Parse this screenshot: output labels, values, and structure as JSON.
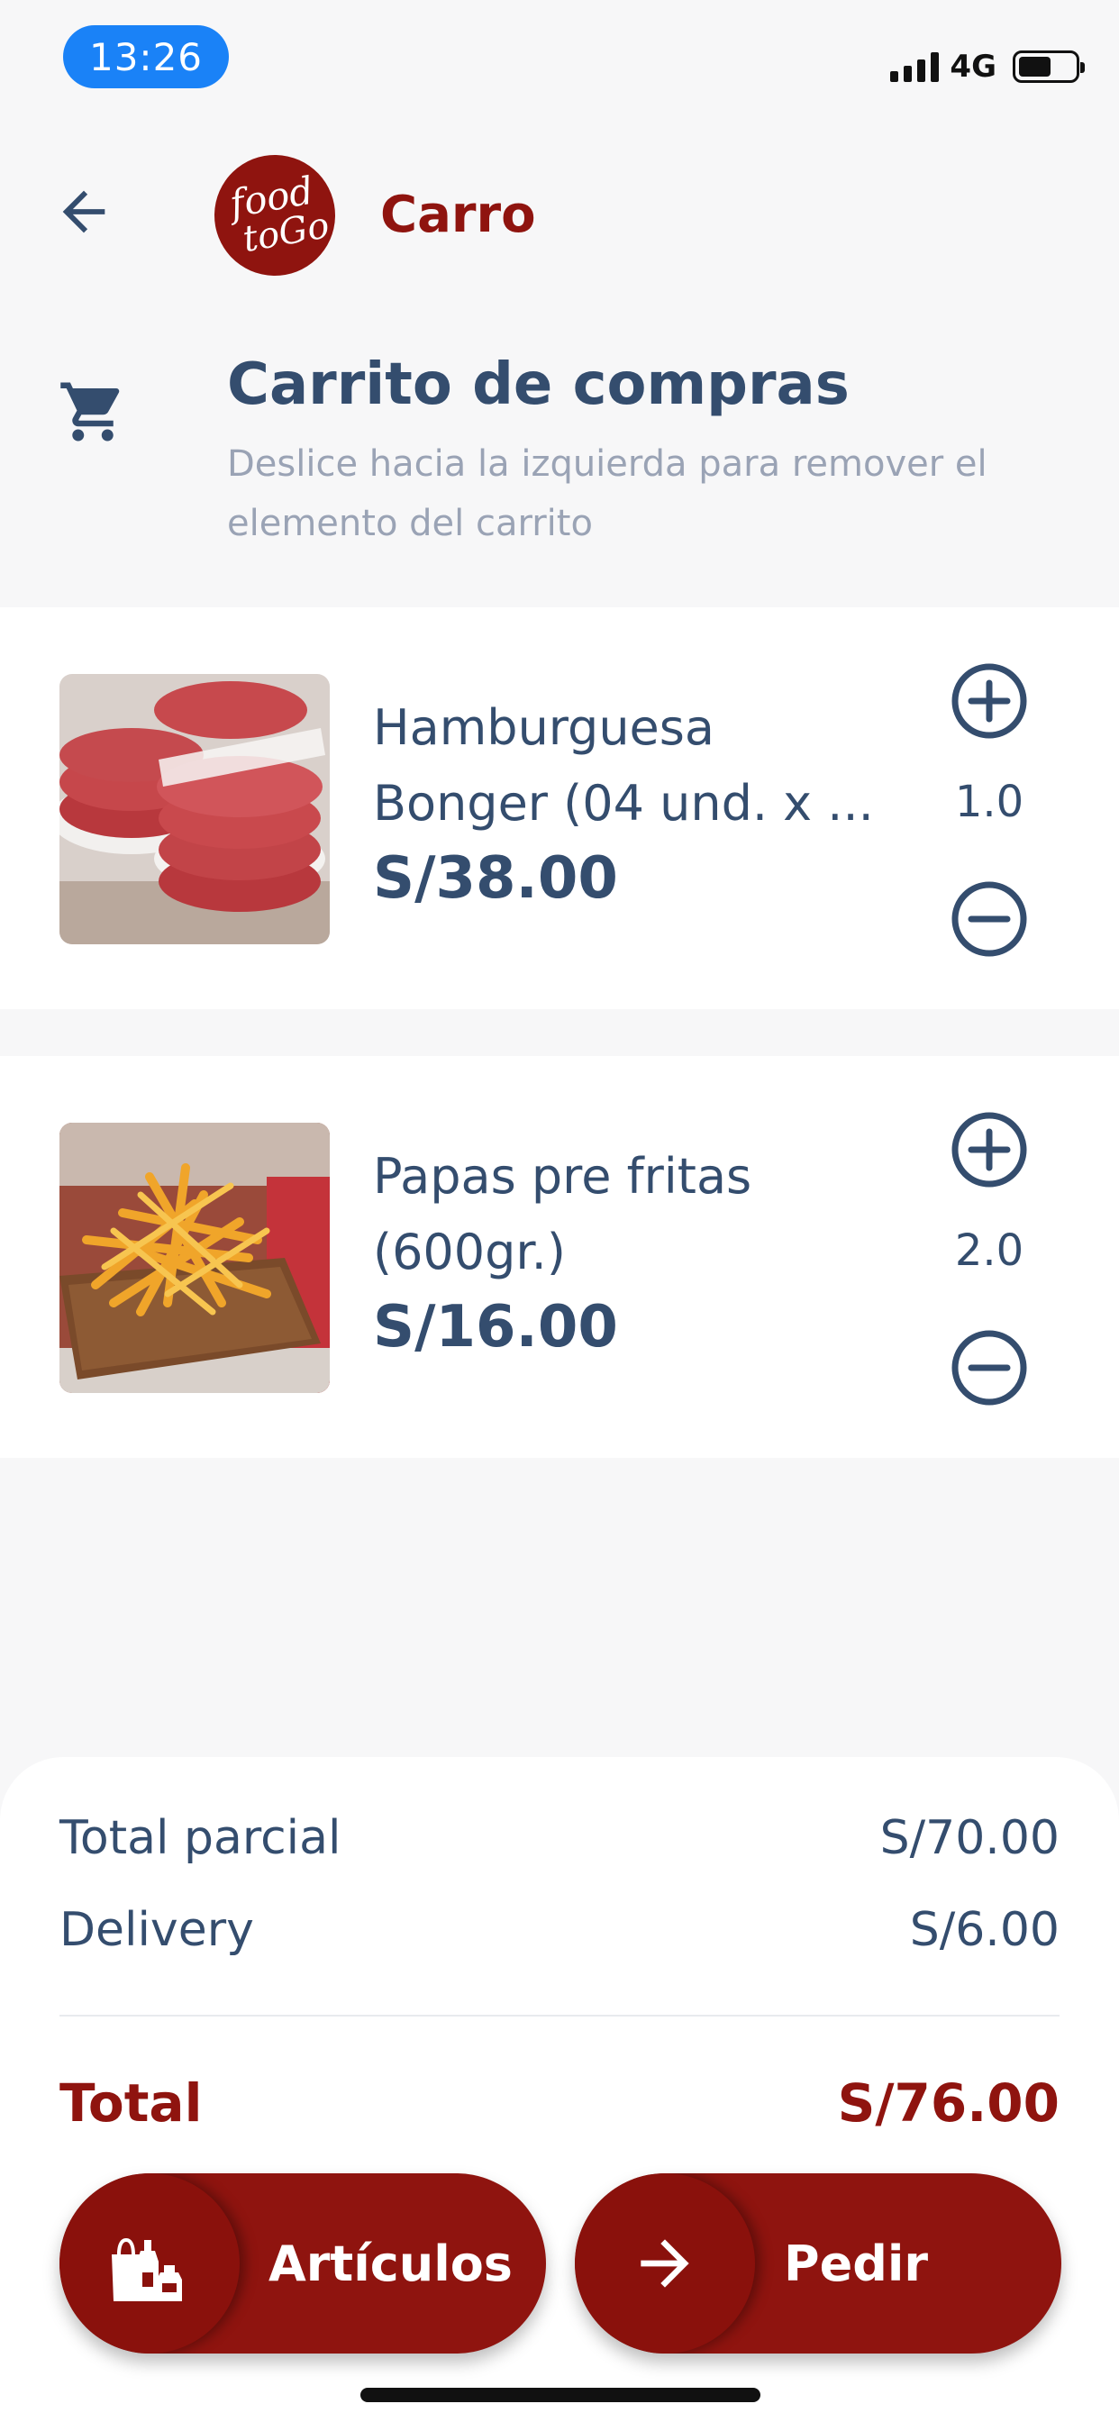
{
  "status_bar": {
    "time": "13:26",
    "network": "4G"
  },
  "app_bar": {
    "title": "Carro",
    "logo_text": [
      "food",
      "toGo"
    ]
  },
  "header": {
    "title": "Carrito de compras",
    "subtitle": "Deslice hacia la izquierda para remover el elemento del carrito"
  },
  "cart_items": [
    {
      "name_lines": [
        "Hamburguesa",
        "Bonger (04 und. x ..."
      ],
      "price": "S/38.00",
      "quantity": "1.0"
    },
    {
      "name_lines": [
        "Papas pre fritas",
        "(600gr.)"
      ],
      "price": "S/16.00",
      "quantity": "2.0"
    }
  ],
  "summary": {
    "subtotal_label": "Total parcial",
    "subtotal_value": "S/70.00",
    "delivery_label": "Delivery",
    "delivery_value": "S/6.00",
    "total_label": "Total",
    "total_value": "S/76.00"
  },
  "actions": {
    "articles_label": "Artículos",
    "order_label": "Pedir"
  },
  "colors": {
    "brand": "#8f140f",
    "text": "#344d6e",
    "muted": "#9aa3b5",
    "status_time_bg": "#1a82f7"
  },
  "icons": [
    "back-arrow-icon",
    "cart-icon",
    "plus-circle-icon",
    "minus-circle-icon",
    "grocery-bag-icon",
    "arrow-right-icon"
  ]
}
